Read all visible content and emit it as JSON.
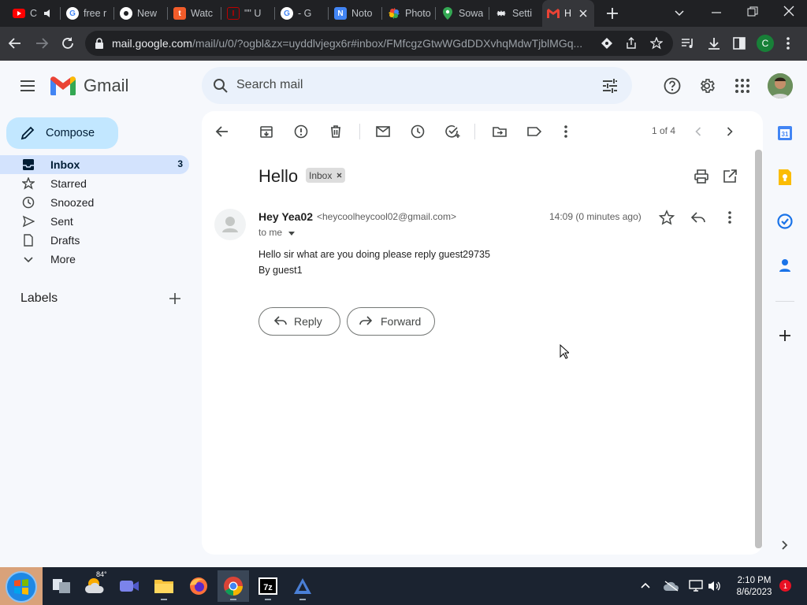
{
  "browser": {
    "tabs": [
      {
        "title": "C",
        "icon": "youtube-icon",
        "color": "#ff0000"
      },
      {
        "title": "free r",
        "icon": "google-icon",
        "color": "#ffffff"
      },
      {
        "title": "New",
        "icon": "chrome-icon",
        "color": "#ffffff"
      },
      {
        "title": "Watc",
        "icon": "tubi-icon",
        "color": "#f25c2a"
      },
      {
        "title": "\"\" U",
        "icon": "letter-box-icon",
        "color": "#c00000"
      },
      {
        "title": "- G",
        "icon": "google-icon",
        "color": "#ffffff"
      },
      {
        "title": "Noto",
        "icon": "noto-icon",
        "color": "#4285f4"
      },
      {
        "title": "Photo",
        "icon": "photos-icon",
        "color": "#fbbc04"
      },
      {
        "title": "Sowa",
        "icon": "maps-pin-icon",
        "color": "#34a853"
      },
      {
        "title": "Setti",
        "icon": "gear-icon",
        "color": "#ffffff"
      },
      {
        "title": "H",
        "icon": "gmail-icon",
        "color": "#ea4335"
      }
    ],
    "url_host": "mail.google.com",
    "url_path": "/mail/u/0/?ogbl&zx=uyddlvjegx6r#inbox/FMfcgzGtwWGdDDXvhqMdwTjblMGq...",
    "profile_initial": "C"
  },
  "gmail": {
    "logo_text": "Gmail",
    "search_placeholder": "Search mail",
    "compose_label": "Compose",
    "nav": [
      {
        "label": "Inbox",
        "count": "3"
      },
      {
        "label": "Starred",
        "count": ""
      },
      {
        "label": "Snoozed",
        "count": ""
      },
      {
        "label": "Sent",
        "count": ""
      },
      {
        "label": "Drafts",
        "count": ""
      },
      {
        "label": "More",
        "count": ""
      }
    ],
    "labels_heading": "Labels",
    "pagination": "1 of 4"
  },
  "email": {
    "subject": "Hello",
    "label_chip": "Inbox",
    "sender_name": "Hey Yea02",
    "sender_email": "<heycoolheycool02@gmail.com>",
    "to": "to me",
    "time": "14:09 (0 minutes ago)",
    "body_line1": "Hello sir what are you doing please reply guest29735",
    "body_line2": "By guest1",
    "reply_label": "Reply",
    "forward_label": "Forward"
  },
  "taskbar": {
    "weather_temp": "84°",
    "time": "2:10 PM",
    "date": "8/6/2023",
    "notification_count": "1"
  },
  "colors": {
    "gmail_bg": "#f6f8fc",
    "compose_bg": "#c2e7ff",
    "inbox_active_bg": "#d3e3fd",
    "search_bg": "#eaf1fb"
  }
}
